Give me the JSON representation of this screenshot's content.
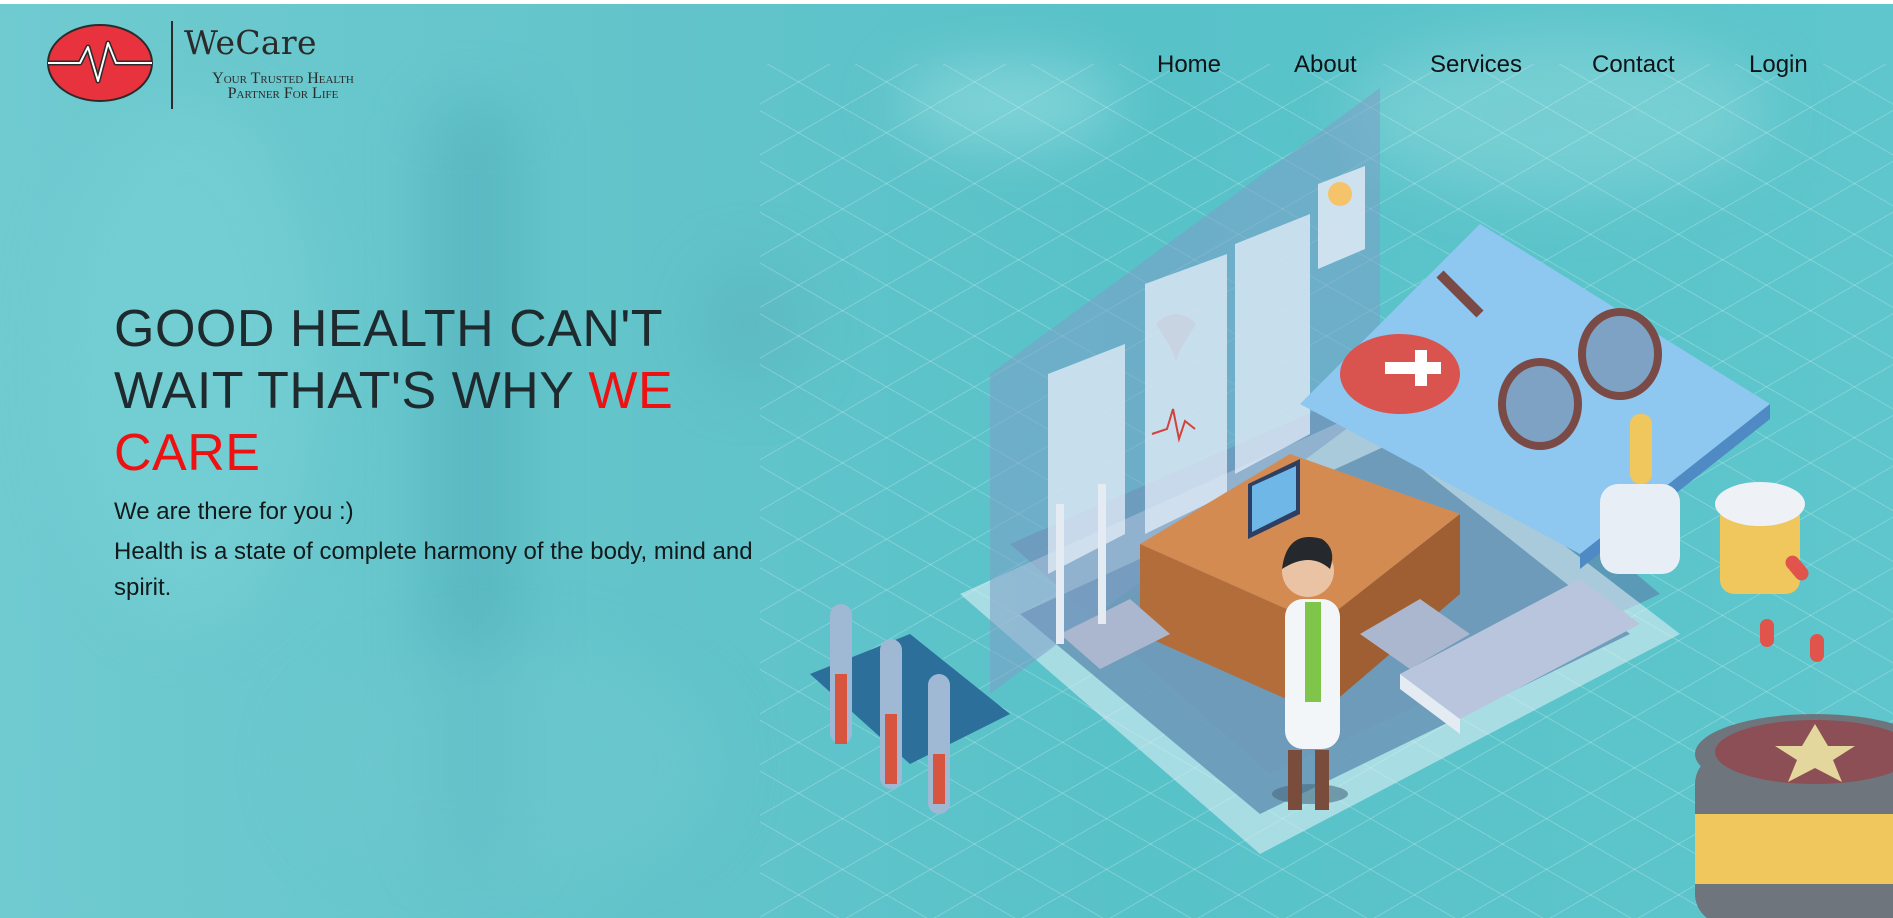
{
  "brand": {
    "name": "WeCare",
    "tagline_line1": "Your Trusted Health",
    "tagline_line2": "Partner For Life",
    "logo_color": "#e8333f"
  },
  "nav": {
    "items": [
      {
        "label": "Home"
      },
      {
        "label": "About"
      },
      {
        "label": "Services"
      },
      {
        "label": "Contact"
      },
      {
        "label": "Login"
      }
    ]
  },
  "hero": {
    "headline_main": "GOOD HEALTH CAN'T WAIT THAT'S WHY ",
    "headline_highlight": "WE CARE",
    "highlight_color": "#ee1111",
    "tagline": "We are there for you :)",
    "description": "Health is a state of complete harmony of the body, mind and spirit."
  },
  "illustration": {
    "icon": "doctor-office-isometric-illustration"
  }
}
